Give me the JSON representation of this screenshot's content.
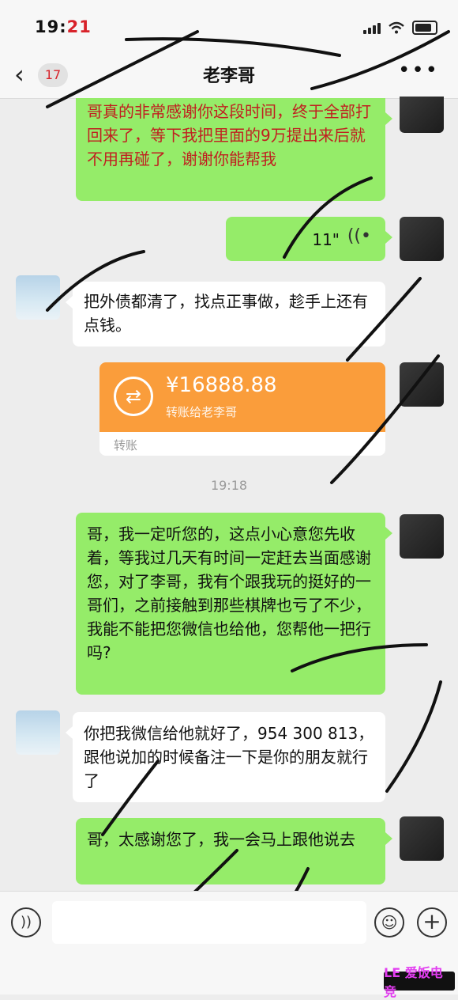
{
  "status_bar": {
    "time_prefix": "19:",
    "time_suffix": "21"
  },
  "nav": {
    "back_count": "17",
    "title": "老李哥",
    "more": "•••"
  },
  "messages": {
    "m1": "哥真的非常感谢你这段时间，终于全部打回来了，等下我把里面的9万提出来后就不用再碰了，谢谢你能帮我",
    "voice_duration": "11\"",
    "m3": "把外债都清了，找点正事做，趁手上还有点钱。",
    "transfer_amount": "¥16888.88",
    "transfer_desc": "转账给老李哥",
    "transfer_footer": "转账",
    "timestamp": "19:18",
    "m5": "哥，我一定听您的，这点小心意您先收着，等我过几天有时间一定赶去当面感谢您，对了李哥，我有个跟我玩的挺好的一哥们，之前接触到那些棋牌也亏了不少，我能不能把您微信也给他，您帮他一把行吗?",
    "m6": "你把我微信给他就好了，954 300 813，跟他说加的时候备注一下是你的朋友就行了",
    "m7": "哥，太感谢您了，我一会马上跟他说去"
  },
  "input_bar": {
    "voice_icon": "voice-icon",
    "emoji_icon": "emoji-icon",
    "plus_icon": "plus-icon"
  },
  "watermark": {
    "text": "LE 爱饭电竞"
  },
  "colors": {
    "out_bubble": "#95ec69",
    "in_bubble": "#ffffff",
    "transfer": "#fa9d3b",
    "accent_red": "#d8222a"
  }
}
